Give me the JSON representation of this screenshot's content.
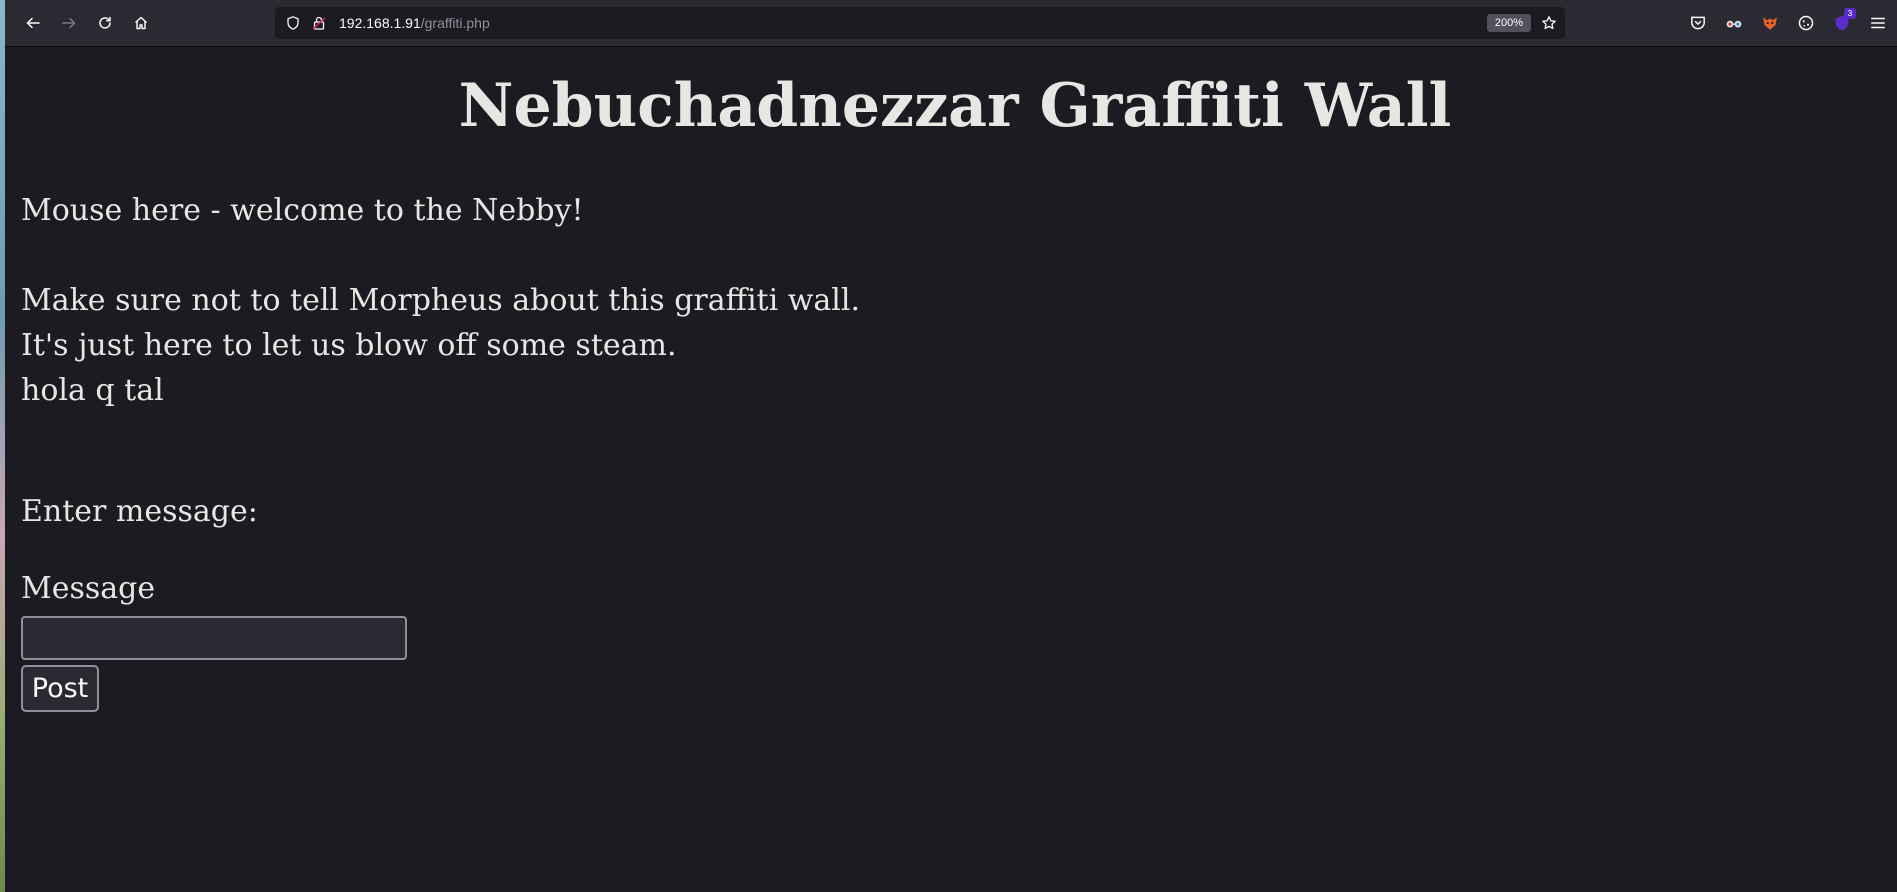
{
  "browser": {
    "url_host": "192.168.1.91",
    "url_path": "/graffiti.php",
    "zoom": "200%",
    "extension_badge": "3"
  },
  "page": {
    "title": "Nebuchadnezzar Graffiti Wall",
    "messages": [
      "Mouse here - welcome to the Nebby!",
      "Make sure not to tell Morpheus about this graffiti wall.",
      "It's just here to let us blow off some steam.",
      "hola q tal"
    ],
    "form": {
      "prompt": "Enter message:",
      "field_label": "Message",
      "field_value": "",
      "submit_label": "Post"
    }
  },
  "colors": {
    "toolbar_bg": "#2b2a33",
    "page_bg": "#1c1b22",
    "text": "#e8e6e3"
  }
}
